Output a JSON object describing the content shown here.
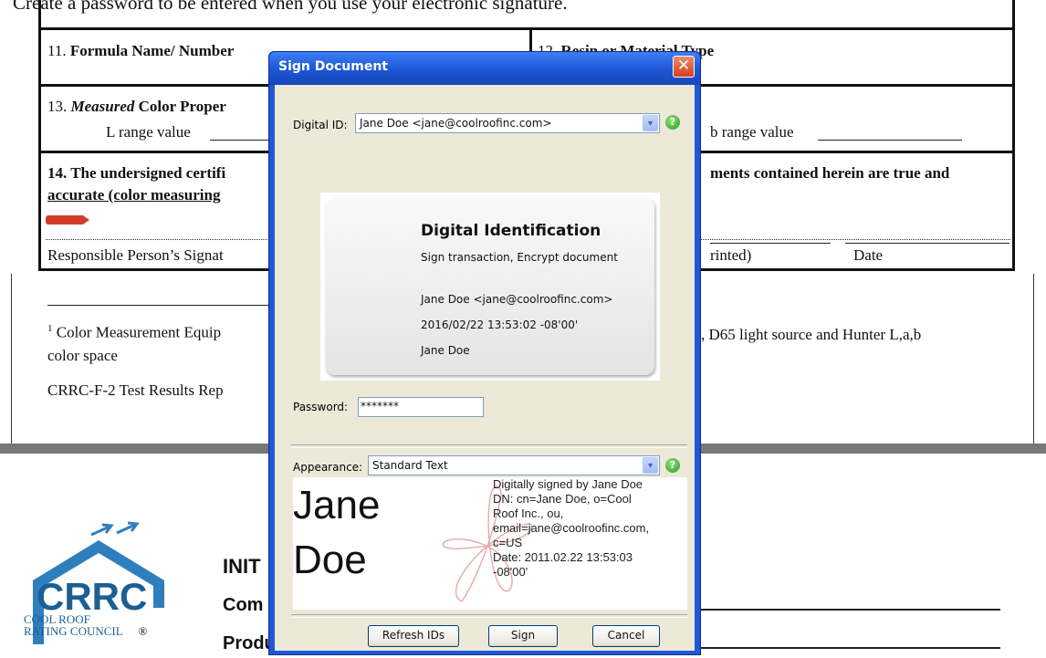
{
  "document": {
    "top_line": "Create a password to be entered when you use your electronic signature.",
    "field11": {
      "num": "11.",
      "label": "Formula Name/ Number"
    },
    "field12": {
      "num": "12.",
      "label": "Resin or Material Type"
    },
    "field13": {
      "num": "13.",
      "italic": "Measured",
      "label": "Color Proper"
    },
    "l_range": "L range value",
    "b_range": "b range value",
    "field14_line1_left": "14. The undersigned certifi",
    "field14_line1_right": "ments contained herein are true and",
    "field14_line2": "accurate (color measuring",
    "sig_label": "Responsible Person’s Signat",
    "printed_label": "rinted)",
    "date_label": "Date",
    "footnote_mark": "1",
    "footnote_left": "Color Measurement Equip",
    "footnote_right": ", D65 light source and Hunter L,a,b",
    "footnote_line2": "color space",
    "report_label": "CRRC-F-2 Test Results Rep",
    "lower_heading": "INIT",
    "lower_comp": "Com",
    "product_label": "Product Brand Name & Model",
    "logo": {
      "letters": "CRRC",
      "line1": "COOL ROOF",
      "line2": "RATING COUNCIL",
      "mark": "®"
    }
  },
  "dialog": {
    "title": "Sign Document",
    "close_symbol": "✕",
    "digital_id_label": "Digital ID:",
    "digital_id_value": "Jane Doe <jane@coolroofinc.com>",
    "card": {
      "title": "Digital Identification",
      "usage": "Sign transaction, Encrypt document",
      "email": "Jane Doe <jane@coolroofinc.com>",
      "date": "2016/02/22 13:53:02 -08'00'",
      "name": "Jane Doe"
    },
    "password_label": "Password:",
    "password_value": "*******",
    "appearance_label": "Appearance:",
    "appearance_value": "Standard Text",
    "preview": {
      "first_name": "Jane",
      "last_name": "Doe",
      "lines": [
        "Digitally signed by Jane Doe",
        "DN: cn=Jane Doe, o=Cool",
        "Roof Inc., ou,",
        "email=jane@coolroofinc.com,",
        "c=US",
        "Date: 2011.02.22 13:53:03",
        "-08'00'"
      ]
    },
    "buttons": {
      "refresh": "Refresh IDs",
      "sign": "Sign",
      "cancel": "Cancel"
    },
    "help_symbol": "?",
    "dropdown_symbol": "▾"
  }
}
